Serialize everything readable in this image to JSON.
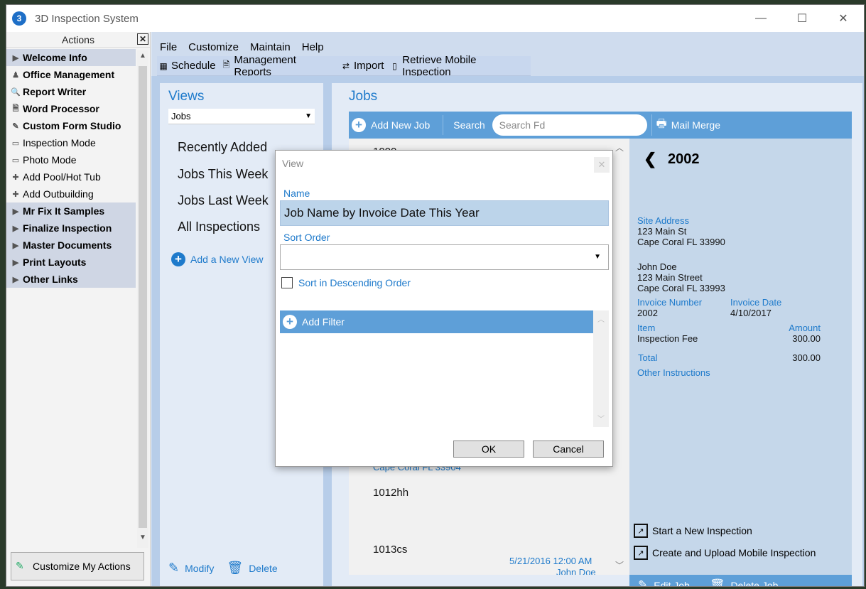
{
  "window": {
    "title": "3D Inspection System",
    "minimize": "—",
    "maximize": "☐",
    "close": "✕"
  },
  "actions_panel": {
    "title": "Actions",
    "close": "✕",
    "items": [
      {
        "label": "Welcome Info",
        "icon": "expand-arrow-icon",
        "glyph": "▶",
        "group": true
      },
      {
        "label": "Office Management",
        "icon": "person-icon",
        "glyph": "♟",
        "bold": true
      },
      {
        "label": "Report Writer",
        "icon": "magnifier-icon",
        "glyph": "🔍",
        "bold": true
      },
      {
        "label": "Word Processor",
        "icon": "document-icon",
        "glyph": "🗎",
        "bold": true
      },
      {
        "label": "Custom Form Studio",
        "icon": "pen-icon",
        "glyph": "✎",
        "bold": true
      },
      {
        "label": "Inspection Mode",
        "icon": "monitor-icon",
        "glyph": "▭"
      },
      {
        "label": "Photo Mode",
        "icon": "monitor-icon",
        "glyph": "▭"
      },
      {
        "label": "Add Pool/Hot Tub",
        "icon": "plus-icon",
        "glyph": "✚"
      },
      {
        "label": "Add Outbuilding",
        "icon": "plus-icon",
        "glyph": "✚"
      },
      {
        "label": "Mr Fix It Samples",
        "icon": "expand-arrow-icon",
        "glyph": "▶",
        "group": true
      },
      {
        "label": "Finalize Inspection",
        "icon": "expand-arrow-icon",
        "glyph": "▶",
        "group": true
      },
      {
        "label": "Master Documents",
        "icon": "expand-arrow-icon",
        "glyph": "▶",
        "group": true
      },
      {
        "label": "Print Layouts",
        "icon": "expand-arrow-icon",
        "glyph": "▶",
        "group": true
      },
      {
        "label": "Other Links",
        "icon": "expand-arrow-icon",
        "glyph": "▶",
        "group": true
      }
    ],
    "customize_label": "Customize My Actions"
  },
  "menu": [
    "File",
    "Customize",
    "Maintain",
    "Help"
  ],
  "toolbar": {
    "schedule": "Schedule",
    "management_reports": "Management Reports",
    "import": "Import",
    "retrieve_mobile": "Retrieve Mobile Inspection"
  },
  "views": {
    "title": "Views",
    "selected": "Jobs",
    "links": [
      "Recently Added",
      "Jobs This Week",
      "Jobs Last Week",
      "All Inspections"
    ],
    "add_view": "Add a New View",
    "modify": "Modify",
    "delete": "Delete"
  },
  "jobs": {
    "title": "Jobs",
    "add_new": "Add New Job",
    "search_label": "Search",
    "search_placeholder": "Search Fd",
    "mail_merge": "Mail Merge",
    "list": {
      "row1": "1000",
      "partial_address": "Cape Coral FL 33904",
      "row2": "1012hh",
      "row3": "1013cs",
      "row3_date": "5/21/2016  12:00 AM",
      "row3_partial": "John Doe"
    }
  },
  "detail": {
    "number": "2002",
    "site_address_label": "Site Address",
    "site_line1": "123 Main St",
    "site_line2": "Cape Coral FL 33990",
    "client_name": "John Doe",
    "client_line1": "123 Main Street",
    "client_line2": "Cape Coral FL  33993",
    "invoice_number_label": "Invoice Number",
    "invoice_number": "2002",
    "invoice_date_label": "Invoice Date",
    "invoice_date": "4/10/2017",
    "item_label": "Item",
    "amount_label": "Amount",
    "item": "Inspection Fee",
    "amount": "300.00",
    "total_label": "Total",
    "total": "300.00",
    "other_instructions": "Other Instructions",
    "start_new": "Start a New Inspection",
    "create_upload": "Create and Upload Mobile Inspection",
    "edit": "Edit Job",
    "delete": "Delete Job"
  },
  "dialog": {
    "title": "View",
    "name_label": "Name",
    "name_value": "Job Name by Invoice Date This Year",
    "sort_label": "Sort Order",
    "sort_value": "",
    "descending_label": "Sort in Descending Order",
    "add_filter": "Add Filter",
    "ok": "OK",
    "cancel": "Cancel"
  }
}
